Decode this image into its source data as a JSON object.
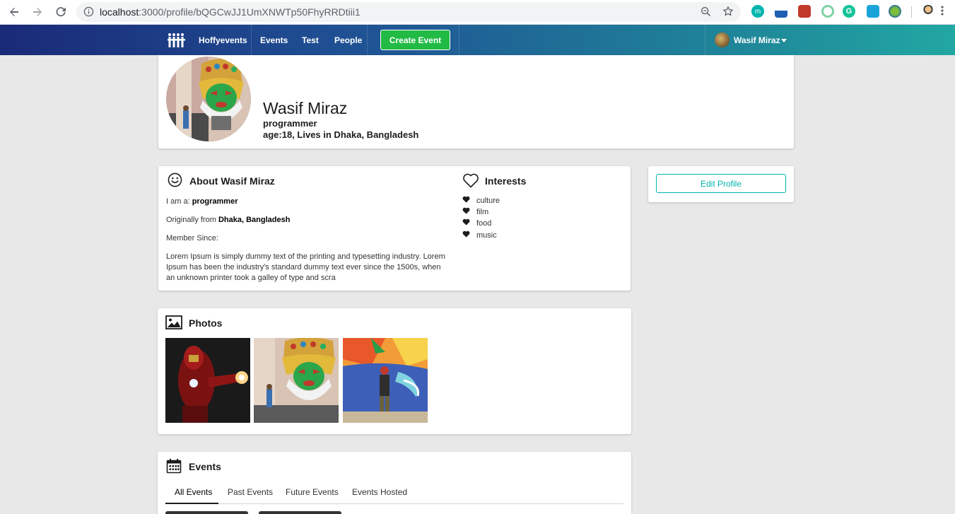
{
  "browser": {
    "url_host": "localhost",
    "url_rest": ":3000/profile/bQGCwJJ1UmXNWTp50FhyRRDtiii1"
  },
  "nav": {
    "brand": "Hoffyevents",
    "events": "Events",
    "test": "Test",
    "people": "People",
    "create_event": "Create Event",
    "user_name": "Wasif Miraz"
  },
  "profile": {
    "name": "Wasif Miraz",
    "occupation": "programmer",
    "age_location": "age:18, Lives in Dhaka, Bangladesh"
  },
  "about": {
    "title": "About Wasif Miraz",
    "i_am_label": "I am a: ",
    "i_am_value": "programmer",
    "from_label": "Originally from ",
    "from_value": "Dhaka, Bangladesh",
    "member_since": "Member Since:",
    "description": "Lorem Ipsum is simply dummy text of the printing and typesetting industry. Lorem Ipsum has been the industry's standard dummy text ever since the 1500s, when an unknown printer took a galley of type and scra"
  },
  "interests": {
    "title": "Interests",
    "items": [
      "culture",
      "film",
      "food",
      "music"
    ]
  },
  "edit_profile": "Edit Profile",
  "photos": {
    "title": "Photos"
  },
  "events": {
    "title": "Events",
    "tabs": [
      "All Events",
      "Past Events",
      "Future Events",
      "Events Hosted"
    ]
  },
  "colors": {
    "nav_start": "#1a2a78",
    "nav_end": "#22a7a3",
    "create_green": "#21ba45",
    "teal": "#00b5ad"
  }
}
